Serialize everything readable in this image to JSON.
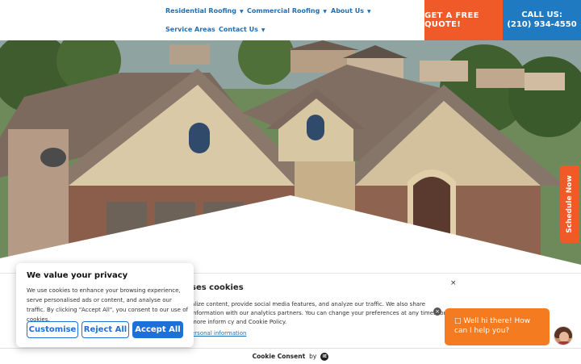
{
  "nav": {
    "items": [
      {
        "label": "Residential Roofing"
      },
      {
        "label": "Commercial Roofing"
      },
      {
        "label": "About Us"
      },
      {
        "label": "Service Areas"
      },
      {
        "label": "Contact Us"
      }
    ],
    "caret": "▼"
  },
  "cta": {
    "quote_label": "GET A FREE QUOTE!",
    "call_label": "CALL US:",
    "phone": "(210) 934-4550",
    "quote_color": "#f05a28",
    "call_color": "#1f7ac2"
  },
  "schedule_tab": {
    "label": "Schedule Now"
  },
  "cookie_panel": {
    "title": "ses cookies",
    "text": "alize content, provide social media features, and analyze our traffic. We also share information with our analytics partners. You can change your preferences at any time. For more inform cy and Cookie Policy.",
    "link": "ersonal information",
    "close": "×",
    "footer_label": "Cookie Consent",
    "footer_by": "by",
    "footer_logo": "IE"
  },
  "privacy": {
    "title": "We value your privacy",
    "text": "We use cookies to enhance your browsing experience, serve personalised ads or content, and analyse our traffic. By clicking \"Accept All\", you consent to our use of cookies.",
    "customise_label": "Customise",
    "reject_label": "Reject All",
    "accept_label": "Accept All",
    "accent": "#1f6fd8"
  },
  "chat": {
    "icon": "chat-icon",
    "message": "Well hi there! How can I help you?",
    "close": "×"
  }
}
